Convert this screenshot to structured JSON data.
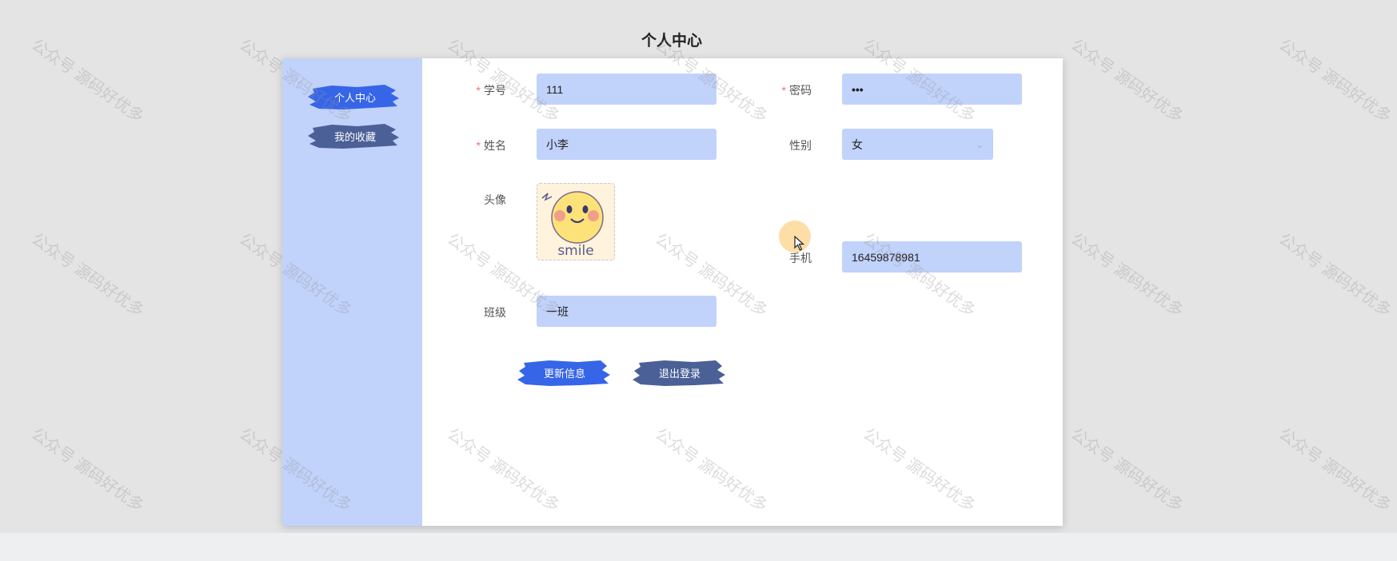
{
  "page": {
    "title": "个人中心"
  },
  "sidebar": {
    "items": [
      {
        "label": "个人中心",
        "color": "#3665e8"
      },
      {
        "label": "我的收藏",
        "color": "#4a6097"
      }
    ]
  },
  "form": {
    "student_id": {
      "label": "学号",
      "required": true,
      "value": "111"
    },
    "password": {
      "label": "密码",
      "required": true,
      "value": "•••"
    },
    "name": {
      "label": "姓名",
      "required": true,
      "value": "小李"
    },
    "gender": {
      "label": "性别",
      "required": false,
      "value": "女"
    },
    "avatar": {
      "label": "头像",
      "image_text": "smile"
    },
    "phone": {
      "label": "手机",
      "required": false,
      "value": "16459878981"
    },
    "class": {
      "label": "班级",
      "required": false,
      "value": "一班"
    }
  },
  "actions": {
    "update_label": "更新信息",
    "logout_label": "退出登录"
  },
  "watermark": {
    "text": "公众号 源码好优多"
  },
  "colors": {
    "accent": "#3665e8",
    "secondary": "#4a6097",
    "field_bg": "#c1d2fb",
    "required": "#f56c6c"
  }
}
